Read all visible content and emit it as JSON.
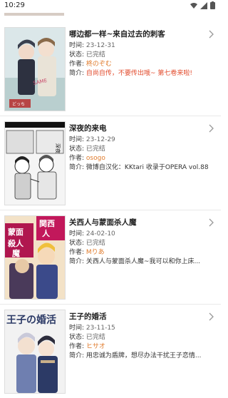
{
  "status_bar": {
    "time": "10:29"
  },
  "labels": {
    "time": "时间:",
    "state": "状态:",
    "author": "作者:",
    "intro": "简介:"
  },
  "items": [
    {
      "title": "哪边都一样~来自过去的刺客",
      "time": "23-12-31",
      "state": "已完结",
      "author": "柊のぞむ",
      "intro": "自尚自传，不要传出哦~ 第七卷来啦!",
      "cover_colors": [
        "#dbe7e9",
        "#8fa8a4",
        "#b74545",
        "#2d3140"
      ]
    },
    {
      "title": "深夜的来电",
      "time": "23-12-29",
      "state": "已完结",
      "author": "osogo",
      "intro": "微博自汉化：KKtari 收录于OPERA vol.88",
      "cover_colors": [
        "#f5f5f5",
        "#cfcfcf",
        "#555555",
        "#111111"
      ]
    },
    {
      "title": "关西人与蒙面杀人魔",
      "time": "24-02-10",
      "state": "已完结",
      "author": "Mりあ",
      "intro": "关西人与蒙面杀人魔~我可以和你上床...",
      "cover_colors": [
        "#f3e2c7",
        "#c2185b",
        "#f0c03c",
        "#3b4a8a"
      ]
    },
    {
      "title": "王子的婚活",
      "time": "23-11-15",
      "state": "已完结",
      "author": "ヒサオ",
      "intro": "用忠诚为盾牌，想尽办法干扰王子恋情...",
      "cover_colors": [
        "#f2f2f2",
        "#6f7fb0",
        "#2c3a66",
        "#c9b08a"
      ]
    }
  ]
}
